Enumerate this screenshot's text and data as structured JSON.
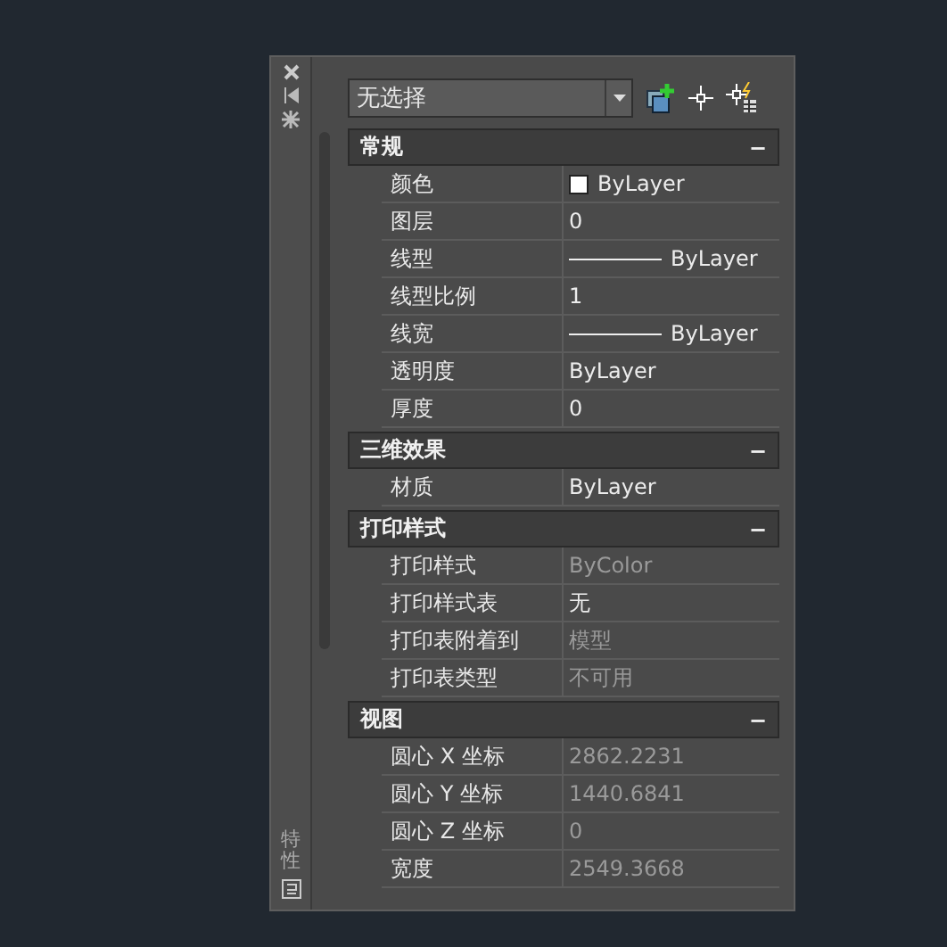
{
  "side_strip": {
    "title": "特性"
  },
  "selector": {
    "value": "无选择"
  },
  "sections": [
    {
      "title": "常规",
      "toggle": "−",
      "expanded": true,
      "rows": [
        {
          "label": "颜色",
          "value": "ByLayer",
          "kind": "color",
          "disabled": false
        },
        {
          "label": "图层",
          "value": "0",
          "kind": "text",
          "disabled": false
        },
        {
          "label": "线型",
          "value": "ByLayer",
          "kind": "line",
          "disabled": false
        },
        {
          "label": "线型比例",
          "value": "1",
          "kind": "text",
          "disabled": false
        },
        {
          "label": "线宽",
          "value": "ByLayer",
          "kind": "line",
          "disabled": false
        },
        {
          "label": "透明度",
          "value": "ByLayer",
          "kind": "text",
          "disabled": false
        },
        {
          "label": "厚度",
          "value": "0",
          "kind": "text",
          "disabled": false
        }
      ]
    },
    {
      "title": "三维效果",
      "toggle": "−",
      "expanded": true,
      "rows": [
        {
          "label": "材质",
          "value": "ByLayer",
          "kind": "text",
          "disabled": false
        }
      ]
    },
    {
      "title": "打印样式",
      "toggle": "−",
      "expanded": true,
      "rows": [
        {
          "label": "打印样式",
          "value": "ByColor",
          "kind": "text",
          "disabled": true
        },
        {
          "label": "打印样式表",
          "value": "无",
          "kind": "text",
          "disabled": false
        },
        {
          "label": "打印表附着到",
          "value": "模型",
          "kind": "text",
          "disabled": true
        },
        {
          "label": "打印表类型",
          "value": "不可用",
          "kind": "text",
          "disabled": true
        }
      ]
    },
    {
      "title": "视图",
      "toggle": "−",
      "expanded": true,
      "rows": [
        {
          "label": "圆心 X 坐标",
          "value": "2862.2231",
          "kind": "text",
          "disabled": true
        },
        {
          "label": "圆心 Y 坐标",
          "value": "1440.6841",
          "kind": "text",
          "disabled": true
        },
        {
          "label": "圆心 Z 坐标",
          "value": "0",
          "kind": "text",
          "disabled": true
        },
        {
          "label": "宽度",
          "value": "2549.3668",
          "kind": "text",
          "disabled": true
        }
      ]
    }
  ]
}
